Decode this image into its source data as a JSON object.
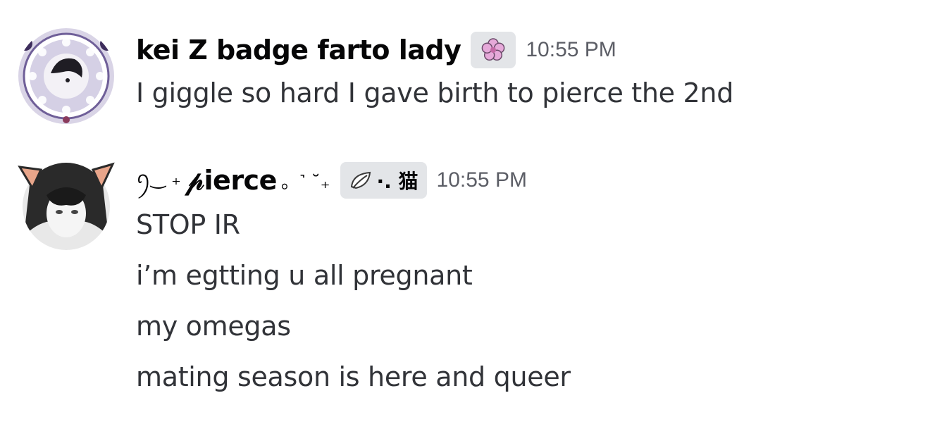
{
  "messages": [
    {
      "username": "kei Z badge farto lady",
      "badge_icon": "cherry-blossom-icon",
      "timestamp": "10:55 PM",
      "lines": [
        "I giggle so hard I gave birth to pierce the 2nd"
      ]
    },
    {
      "username_prefix": "ꪆ‿ ₊",
      "username_main": "𝓅ierce",
      "username_suffix": "。˺ ˘₊",
      "badge_icon": "leaf-icon",
      "badge_text": "·. 猫",
      "timestamp": "10:55 PM",
      "lines": [
        "STOP IR",
        "i’m egtting u all pregnant",
        "my omegas",
        "mating season is here and queer"
      ]
    }
  ],
  "colors": {
    "username": "#060607",
    "message_text": "#313338",
    "timestamp": "#5c5e66",
    "badge_bg": "#e3e5e8"
  }
}
